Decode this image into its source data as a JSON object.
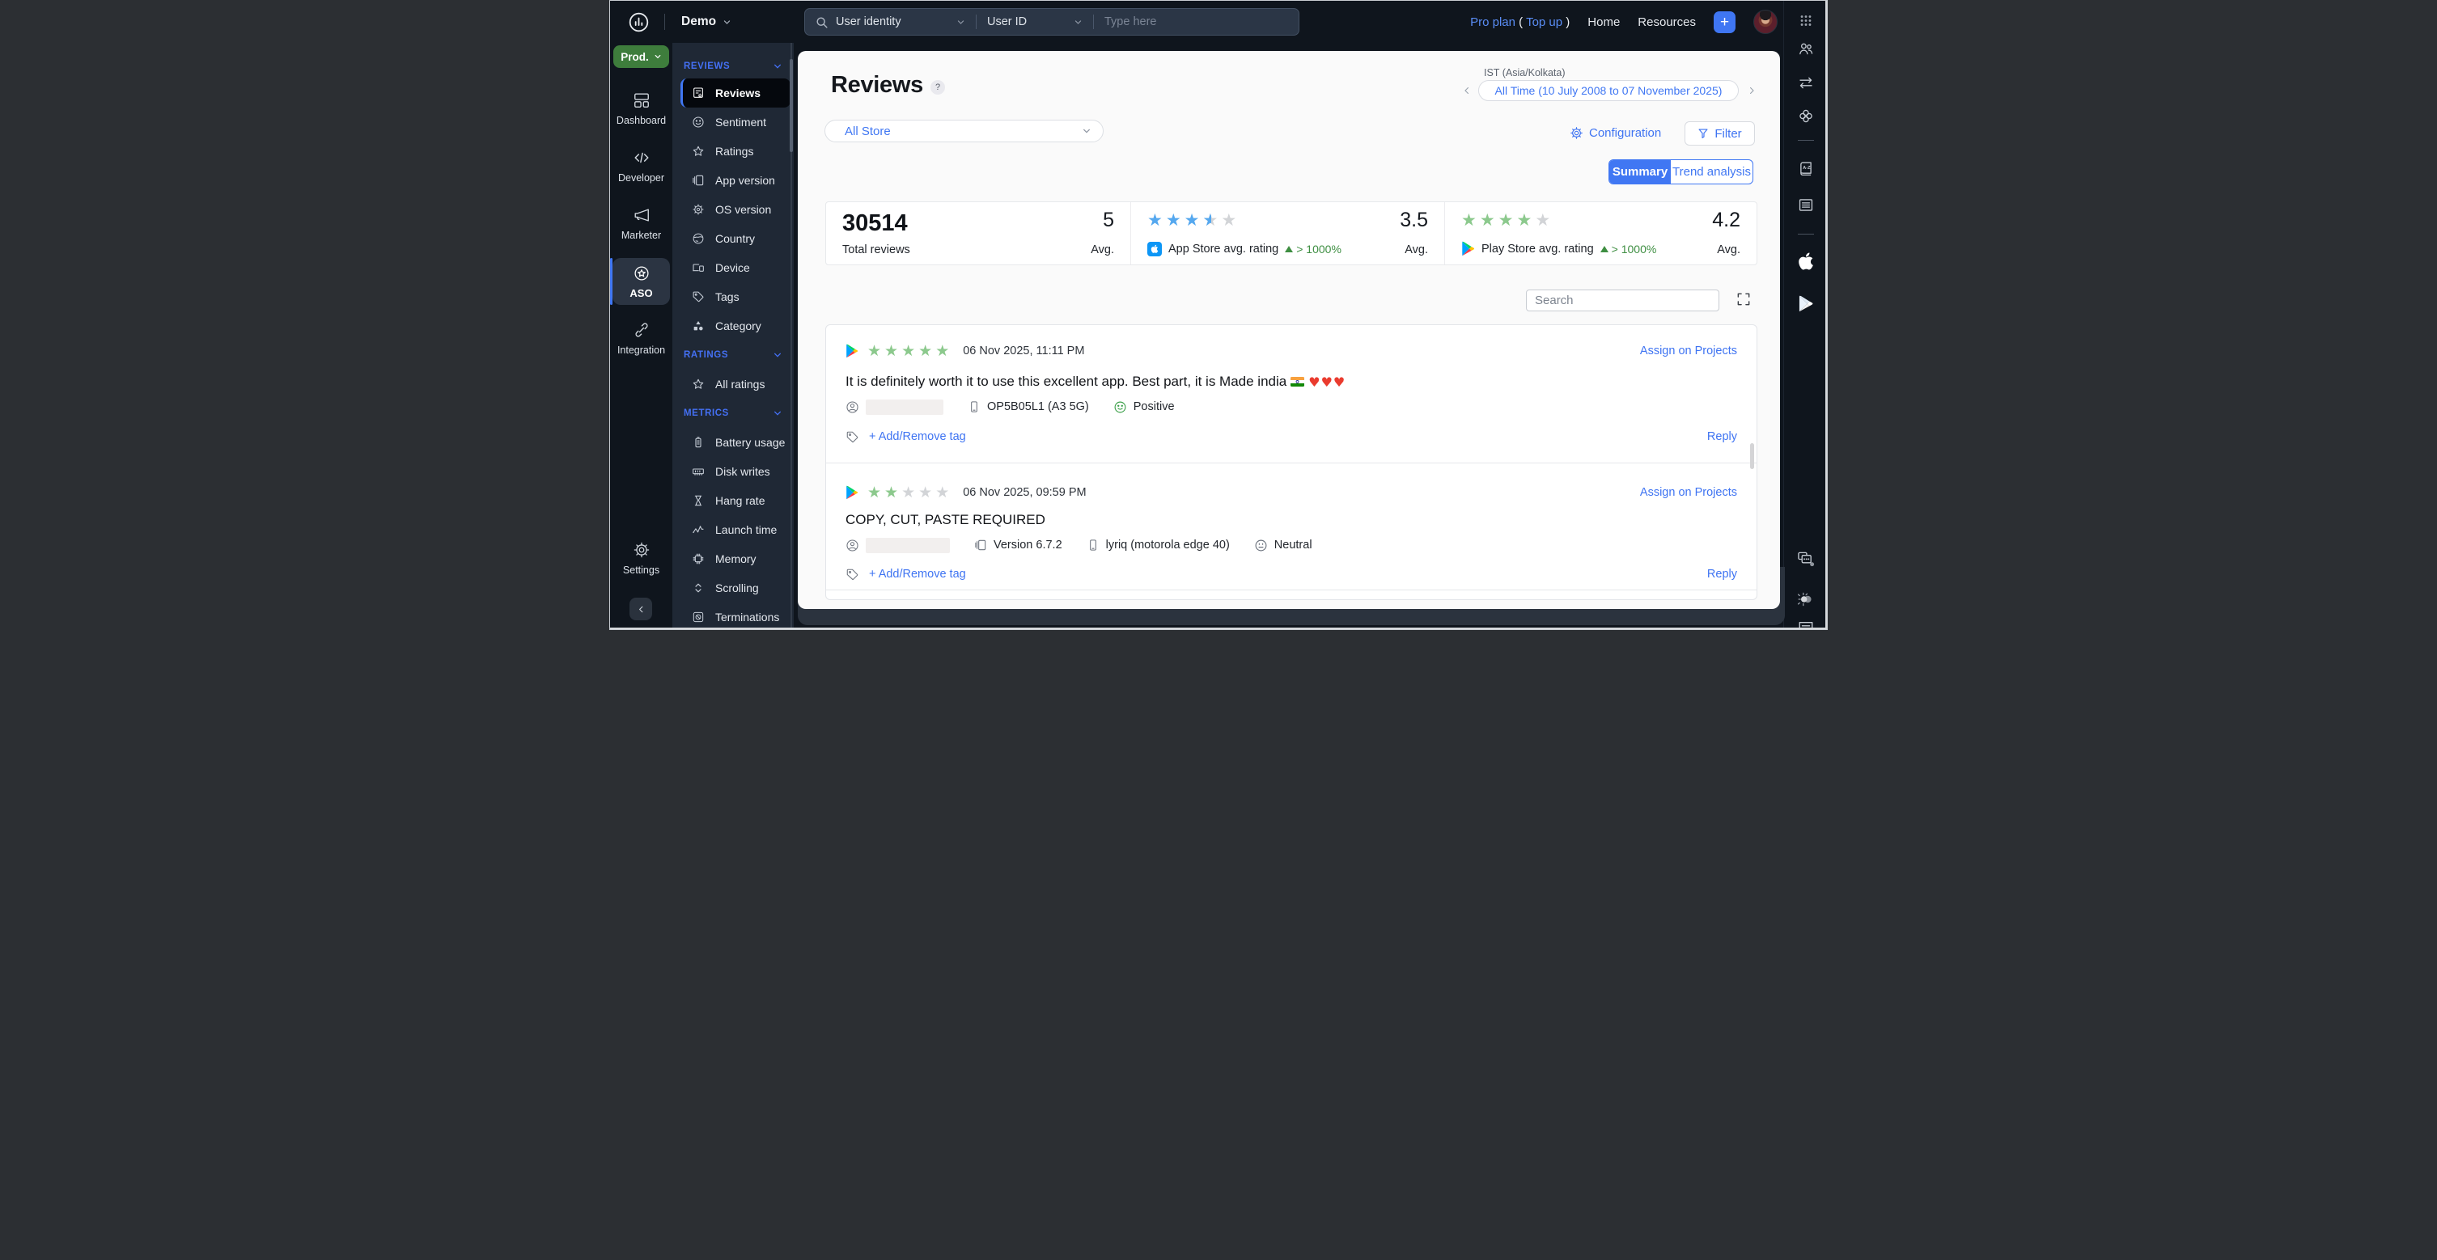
{
  "topbar": {
    "product": "Demo",
    "search_scope": "User identity",
    "search_field": "User ID",
    "search_placeholder": "Type here",
    "plan": "Pro plan",
    "plan_open": "(",
    "plan_topup": "Top up",
    "plan_close": ")",
    "home": "Home",
    "resources": "Resources"
  },
  "leftrail": {
    "env": "Prod.",
    "dashboard": "Dashboard",
    "developer": "Developer",
    "marketer": "Marketer",
    "aso": "ASO",
    "integration": "Integration",
    "settings": "Settings"
  },
  "sidebar": {
    "reviews_header": "REVIEWS",
    "reviews_items": [
      "Reviews",
      "Sentiment",
      "Ratings",
      "App version",
      "OS version",
      "Country",
      "Device",
      "Tags",
      "Category"
    ],
    "ratings_header": "RATINGS",
    "ratings_items": [
      "All ratings"
    ],
    "metrics_header": "METRICS",
    "metrics_items": [
      "Battery usage",
      "Disk writes",
      "Hang rate",
      "Launch time",
      "Memory",
      "Scrolling",
      "Terminations"
    ]
  },
  "header": {
    "title": "Reviews",
    "help": "?",
    "timezone": "IST (Asia/Kolkata)",
    "date_range": "All Time (10 July 2008 to 07 November 2025)",
    "store_filter": "All Store",
    "configuration": "Configuration",
    "filter": "Filter"
  },
  "tabs": {
    "summary": "Summary",
    "trend": "Trend analysis"
  },
  "stats": {
    "total": "30514",
    "total_label": "Total reviews",
    "total_avg": "5",
    "avg_label": "Avg.",
    "appstore_label": "App Store avg. rating",
    "appstore_change": "> 1000%",
    "appstore_stars": 3.5,
    "appstore_avg": "3.5",
    "playstore_label": "Play Store avg. rating",
    "playstore_change": "> 1000%",
    "playstore_stars": 4,
    "playstore_avg": "4.2"
  },
  "list": {
    "search_placeholder": "Search",
    "assign": "Assign on Projects",
    "tag_action": "+ Add/Remove tag",
    "reply": "Reply"
  },
  "reviews": [
    {
      "store": "play",
      "rating": 5,
      "date": "06 Nov 2025, 11:11 PM",
      "text": "It is definitely worth it to use this excellent app. Best part, it is Made india",
      "emoji_hearts": "♥♥♥",
      "device": "OP5B05L1 (A3 5G)",
      "sentiment": "Positive"
    },
    {
      "store": "play",
      "rating": 2,
      "date": "06 Nov 2025, 09:59 PM",
      "text": "COPY, CUT, PASTE REQUIRED",
      "app_version": "Version 6.7.2",
      "device": "lyriq (motorola edge 40)",
      "sentiment": "Neutral"
    }
  ],
  "icons": {
    "plus": "+",
    "star_glyph": "★"
  }
}
